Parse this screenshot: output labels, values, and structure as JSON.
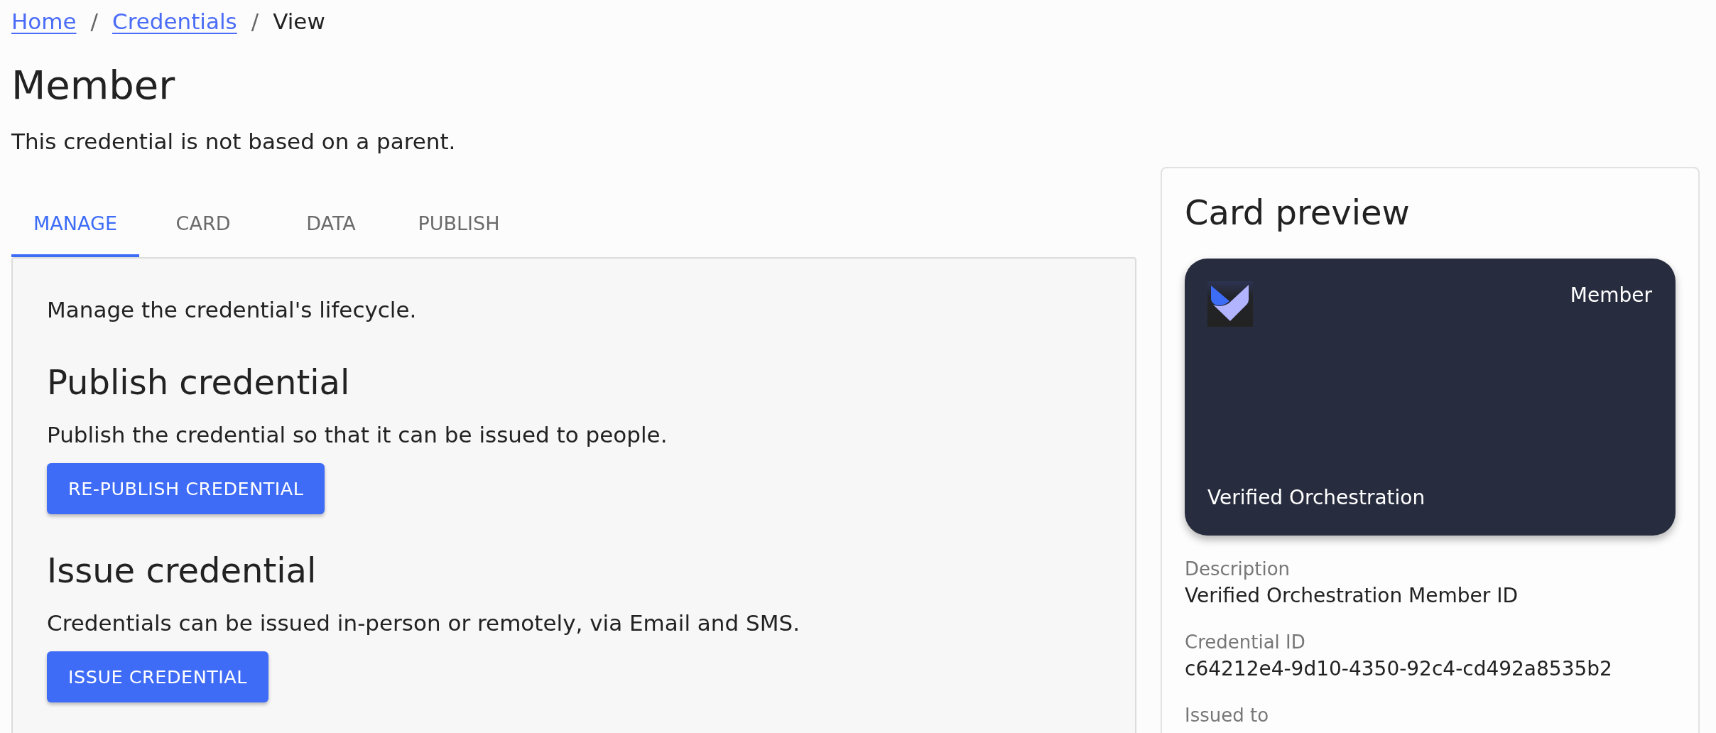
{
  "breadcrumb": [
    {
      "label": "Home",
      "kind": "link"
    },
    {
      "label": "/",
      "kind": "separator"
    },
    {
      "label": "Credentials",
      "kind": "link"
    },
    {
      "label": "/",
      "kind": "separator"
    },
    {
      "label": "View",
      "kind": "current"
    }
  ],
  "title": "Member",
  "subtitle": "This credential is not based on a parent.",
  "tabs": [
    {
      "label": "MANAGE",
      "selected": true
    },
    {
      "label": "CARD",
      "selected": false
    },
    {
      "label": "DATA",
      "selected": false
    },
    {
      "label": "PUBLISH",
      "selected": false
    }
  ],
  "panel": {
    "intro": "Manage the credential's lifecycle.",
    "sections": [
      {
        "heading": "Publish credential",
        "text": "Publish the credential so that it can be issued to people.",
        "button": "RE-PUBLISH CREDENTIAL"
      },
      {
        "heading": "Issue credential",
        "text": "Credentials can be issued in-person or remotely, via Email and SMS.",
        "button": "ISSUE CREDENTIAL"
      }
    ]
  },
  "card_preview": {
    "title": "Card preview",
    "card": {
      "name": "Member",
      "issuer": "Verified Orchestration"
    },
    "fields": [
      {
        "label": "Description",
        "value": "Verified Orchestration Member ID"
      },
      {
        "label": "Credential ID",
        "value": "c64212e4-9d10-4350-92c4-cd492a8535b2"
      },
      {
        "label": "Issued to"
      }
    ]
  }
}
